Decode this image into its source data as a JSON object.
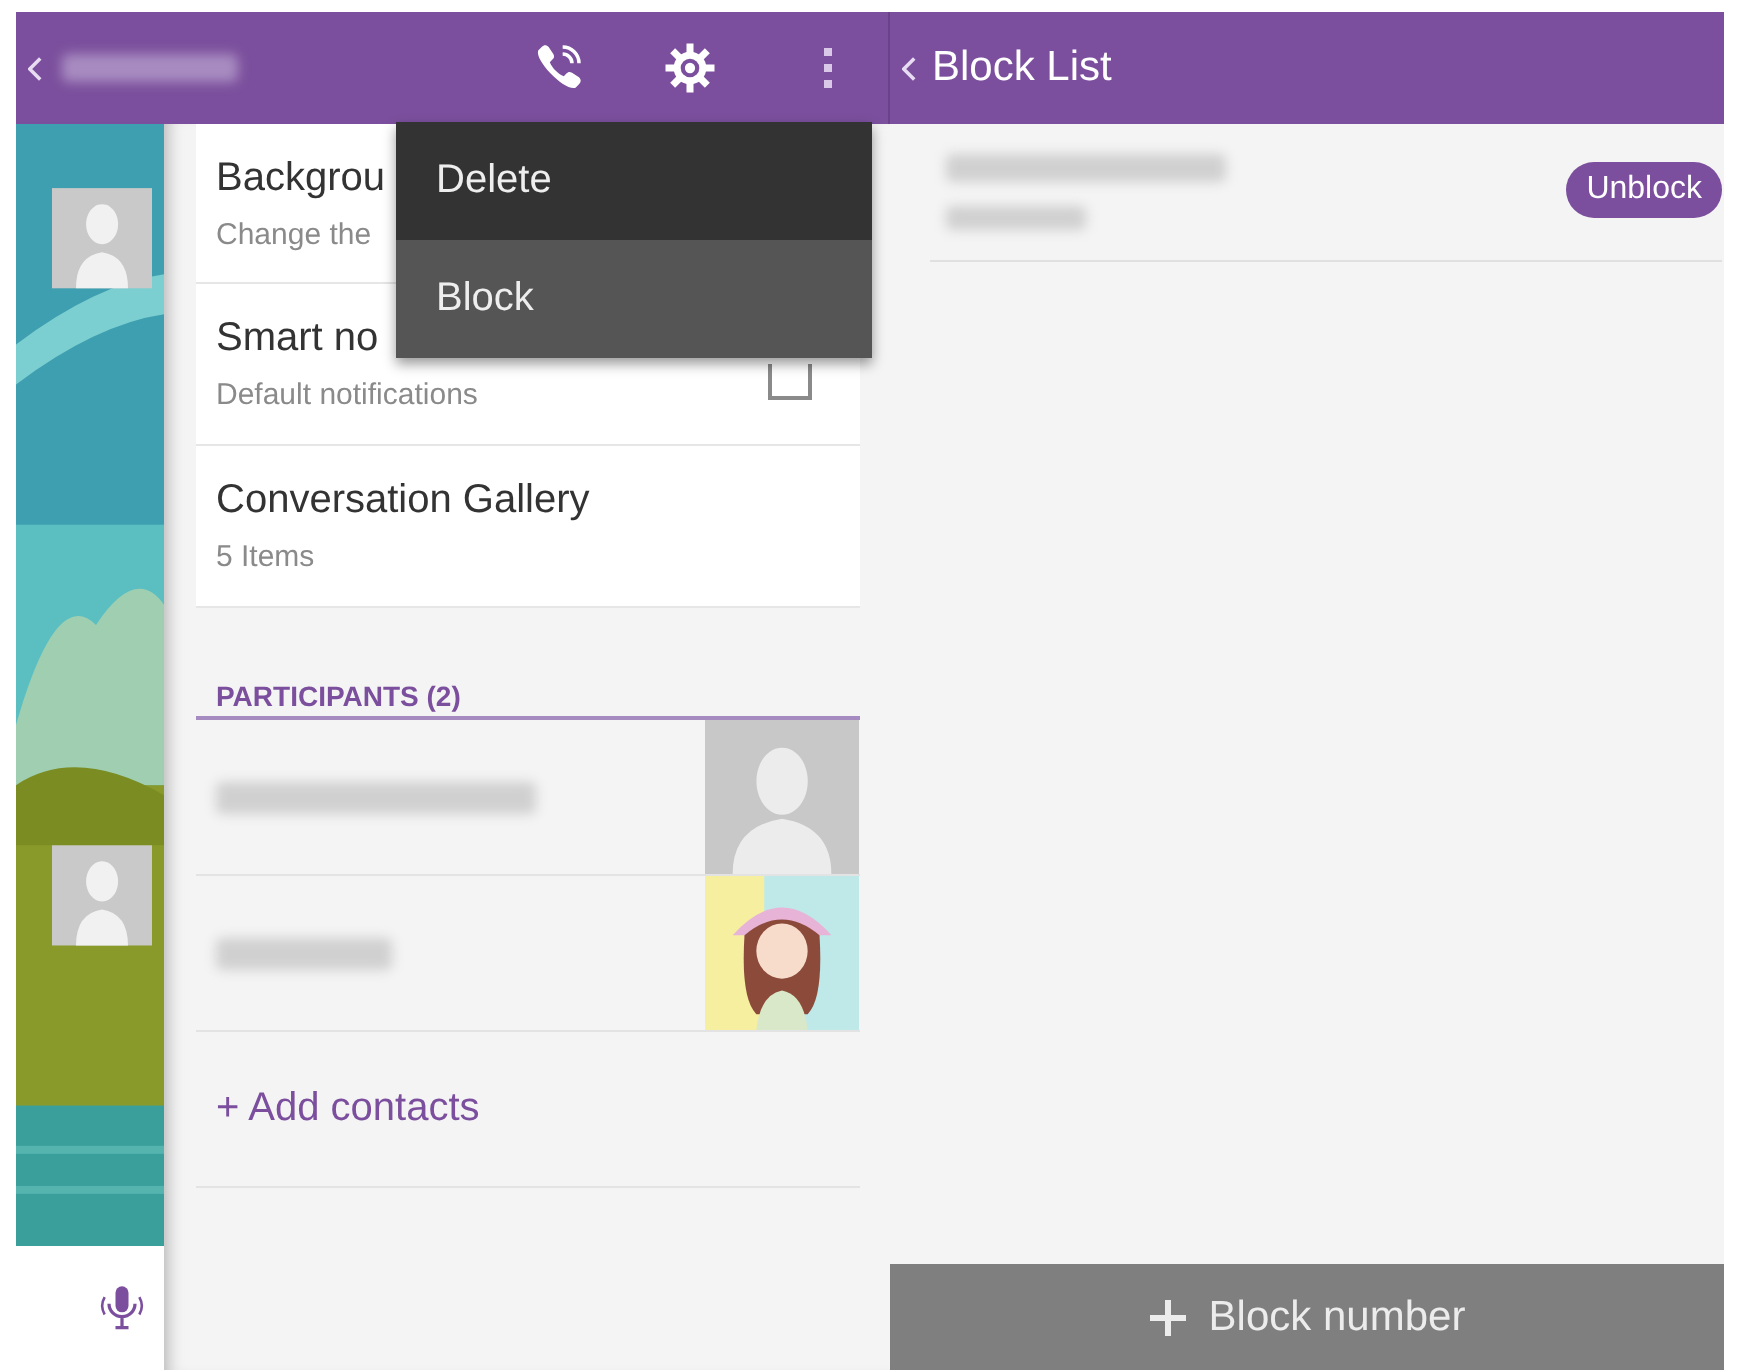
{
  "settings": [
    {
      "kind": "text",
      "title": "Backgrou",
      "subtitle": "Change the"
    },
    {
      "kind": "checkbox",
      "title": "Smart no",
      "subtitle": "Default notifications",
      "checked": false
    },
    {
      "kind": "text",
      "title": "Conversation Gallery",
      "subtitle": "5 Items"
    }
  ],
  "participants": {
    "heading": "PARTICIPANTS (2)",
    "members": [
      {
        "kind": "silhouette"
      },
      {
        "kind": "picture"
      }
    ],
    "add": "+ Add contacts"
  },
  "menu": [
    {
      "label": "Delete",
      "selected": false
    },
    {
      "label": "Block",
      "selected": true
    }
  ],
  "block_list": {
    "title": "Block List",
    "entries": [
      {
        "action": "Unblock"
      }
    ],
    "add_button": "Block number"
  }
}
